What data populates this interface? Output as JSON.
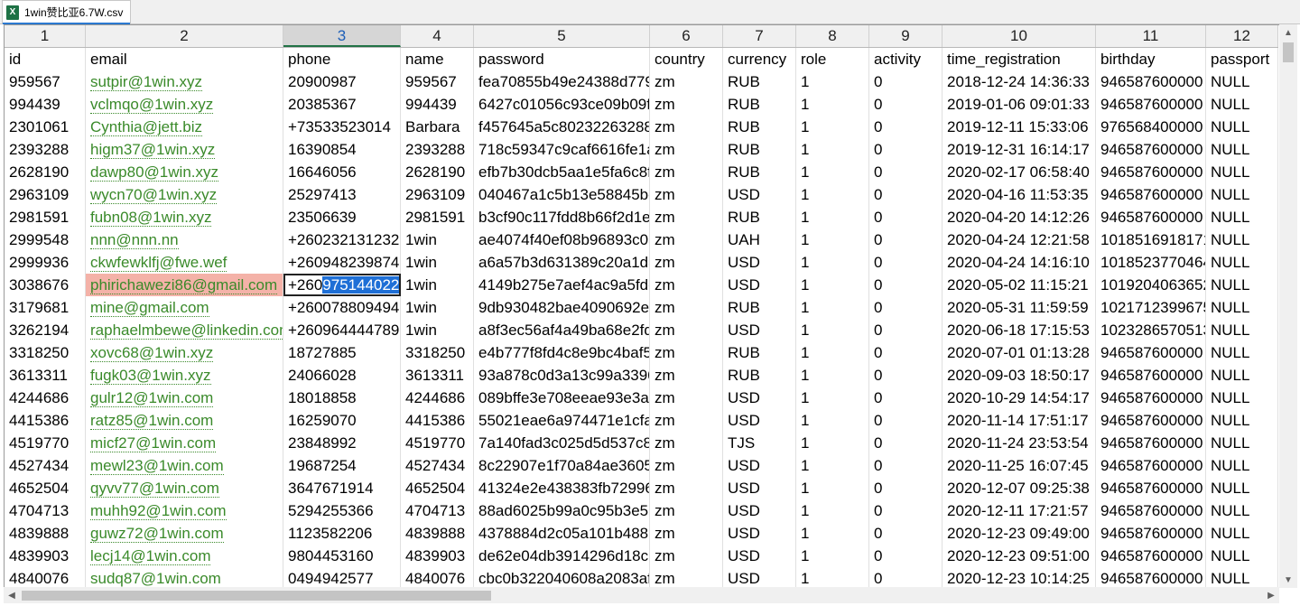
{
  "tab": {
    "title": "1win赞比亚6.7W.csv",
    "icon": "excel-file-icon"
  },
  "column_numbers": [
    "1",
    "2",
    "3",
    "4",
    "5",
    "6",
    "7",
    "8",
    "9",
    "10",
    "11",
    "12"
  ],
  "selected_column": 2,
  "rows": [
    [
      "id",
      "email",
      "phone",
      "name",
      "password",
      "country",
      "currency",
      "role",
      "activity",
      "time_registration",
      "birthday",
      "passport"
    ],
    [
      "959567",
      "sutpir@1win.xyz",
      "20900987",
      "959567",
      "fea70855b49e24388d779",
      "zm",
      "RUB",
      "1",
      "0",
      "2018-12-24 14:36:33",
      "946587600000",
      "NULL"
    ],
    [
      "994439",
      "vclmqo@1win.xyz",
      "20385367",
      "994439",
      "6427c01056c93ce09b09f5",
      "zm",
      "RUB",
      "1",
      "0",
      "2019-01-06 09:01:33",
      "946587600000",
      "NULL"
    ],
    [
      "2301061",
      "Cynthia@jett.biz",
      "+73533523014",
      "Barbara",
      "f457645a5c80232263288",
      "zm",
      "RUB",
      "1",
      "0",
      "2019-12-11 15:33:06",
      "976568400000",
      "NULL"
    ],
    [
      "2393288",
      "higm37@1win.xyz",
      "16390854",
      "2393288",
      "718c59347c9caf6616fe1a",
      "zm",
      "RUB",
      "1",
      "0",
      "2019-12-31 16:14:17",
      "946587600000",
      "NULL"
    ],
    [
      "2628190",
      "dawp80@1win.xyz",
      "16646056",
      "2628190",
      "efb7b30dcb5aa1e5fa6c8f",
      "zm",
      "RUB",
      "1",
      "0",
      "2020-02-17 06:58:40",
      "946587600000",
      "NULL"
    ],
    [
      "2963109",
      "wycn70@1win.xyz",
      "25297413",
      "2963109",
      "040467a1c5b13e58845be",
      "zm",
      "USD",
      "1",
      "0",
      "2020-04-16 11:53:35",
      "946587600000",
      "NULL"
    ],
    [
      "2981591",
      "fubn08@1win.xyz",
      "23506639",
      "2981591",
      "b3cf90c117fdd8b66f2d1e",
      "zm",
      "RUB",
      "1",
      "0",
      "2020-04-20 14:12:26",
      "946587600000",
      "NULL"
    ],
    [
      "2999548",
      "nnn@nnn.nn",
      "+260232131232",
      "1win",
      "ae4074f40ef08b96893c03",
      "zm",
      "UAH",
      "1",
      "0",
      "2020-04-24 12:21:58",
      "1018516918171",
      "NULL"
    ],
    [
      "2999936",
      "ckwfewklfj@fwe.wef",
      "+260948239874",
      "1win",
      "a6a57b3d631389c20a1d8",
      "zm",
      "USD",
      "1",
      "0",
      "2020-04-24 14:16:10",
      "1018523770464",
      "NULL"
    ],
    [
      "3038676",
      "phirichawezi86@gmail.com",
      "+260975144022",
      "1win",
      "4149b275e7aef4ac9a5fdc",
      "zm",
      "USD",
      "1",
      "0",
      "2020-05-02 11:15:21",
      "1019204063652",
      "NULL"
    ],
    [
      "3179681",
      "mine@gmail.com",
      "+260078809494",
      "1win",
      "9db930482bae4090692e",
      "zm",
      "RUB",
      "1",
      "0",
      "2020-05-31 11:59:59",
      "1021712399675",
      "NULL"
    ],
    [
      "3262194",
      "raphaelmbewe@linkedin.com",
      "+260964444789",
      "1win",
      "a8f3ec56af4a49ba68e2fd",
      "zm",
      "USD",
      "1",
      "0",
      "2020-06-18 17:15:53",
      "1023286570513",
      "NULL"
    ],
    [
      "3318250",
      "xovc68@1win.xyz",
      "18727885",
      "3318250",
      "e4b777f8fd4c8e9bc4baf5",
      "zm",
      "RUB",
      "1",
      "0",
      "2020-07-01 01:13:28",
      "946587600000",
      "NULL"
    ],
    [
      "3613311",
      "fugk03@1win.xyz",
      "24066028",
      "3613311",
      "93a878c0d3a13c99a3396",
      "zm",
      "RUB",
      "1",
      "0",
      "2020-09-03 18:50:17",
      "946587600000",
      "NULL"
    ],
    [
      "4244686",
      "gulr12@1win.com",
      "18018858",
      "4244686",
      "089bffe3e708eeae93e3a4",
      "zm",
      "USD",
      "1",
      "0",
      "2020-10-29 14:54:17",
      "946587600000",
      "NULL"
    ],
    [
      "4415386",
      "ratz85@1win.com",
      "16259070",
      "4415386",
      "55021eae6a974471e1cfa",
      "zm",
      "USD",
      "1",
      "0",
      "2020-11-14 17:51:17",
      "946587600000",
      "NULL"
    ],
    [
      "4519770",
      "micf27@1win.com",
      "23848992",
      "4519770",
      "7a140fad3c025d5d537c8",
      "zm",
      "TJS",
      "1",
      "0",
      "2020-11-24 23:53:54",
      "946587600000",
      "NULL"
    ],
    [
      "4527434",
      "mewl23@1win.com",
      "19687254",
      "4527434",
      "8c22907e1f70a84ae3605",
      "zm",
      "USD",
      "1",
      "0",
      "2020-11-25 16:07:45",
      "946587600000",
      "NULL"
    ],
    [
      "4652504",
      "qyvv77@1win.com",
      "3647671914",
      "4652504",
      "41324e2e438383fb72996",
      "zm",
      "USD",
      "1",
      "0",
      "2020-12-07 09:25:38",
      "946587600000",
      "NULL"
    ],
    [
      "4704713",
      "muhh92@1win.com",
      "5294255366",
      "4704713",
      "88ad6025b99a0c95b3e51",
      "zm",
      "USD",
      "1",
      "0",
      "2020-12-11 17:21:57",
      "946587600000",
      "NULL"
    ],
    [
      "4839888",
      "guwz72@1win.com",
      "1123582206",
      "4839888",
      "4378884d2c05a101b4886",
      "zm",
      "USD",
      "1",
      "0",
      "2020-12-23 09:49:00",
      "946587600000",
      "NULL"
    ],
    [
      "4839903",
      "lecj14@1win.com",
      "9804453160",
      "4839903",
      "de62e04db3914296d18c7",
      "zm",
      "USD",
      "1",
      "0",
      "2020-12-23 09:51:00",
      "946587600000",
      "NULL"
    ],
    [
      "4840076",
      "sudq87@1win.com",
      "0494942577",
      "4840076",
      "cbc0b322040608a2083af",
      "zm",
      "USD",
      "1",
      "0",
      "2020-12-23 10:14:25",
      "946587600000",
      "NULL"
    ]
  ],
  "highlighted_cell": {
    "row": 10,
    "col": 1,
    "color": "#f4b2a8"
  },
  "selected_cell": {
    "row": 10,
    "col": 2,
    "plain": "+260",
    "selected_text": "975144022"
  },
  "colors": {
    "link": "#3a8a2a",
    "selection": "#1e6fd6",
    "header_bg": "#f0f0f0"
  }
}
